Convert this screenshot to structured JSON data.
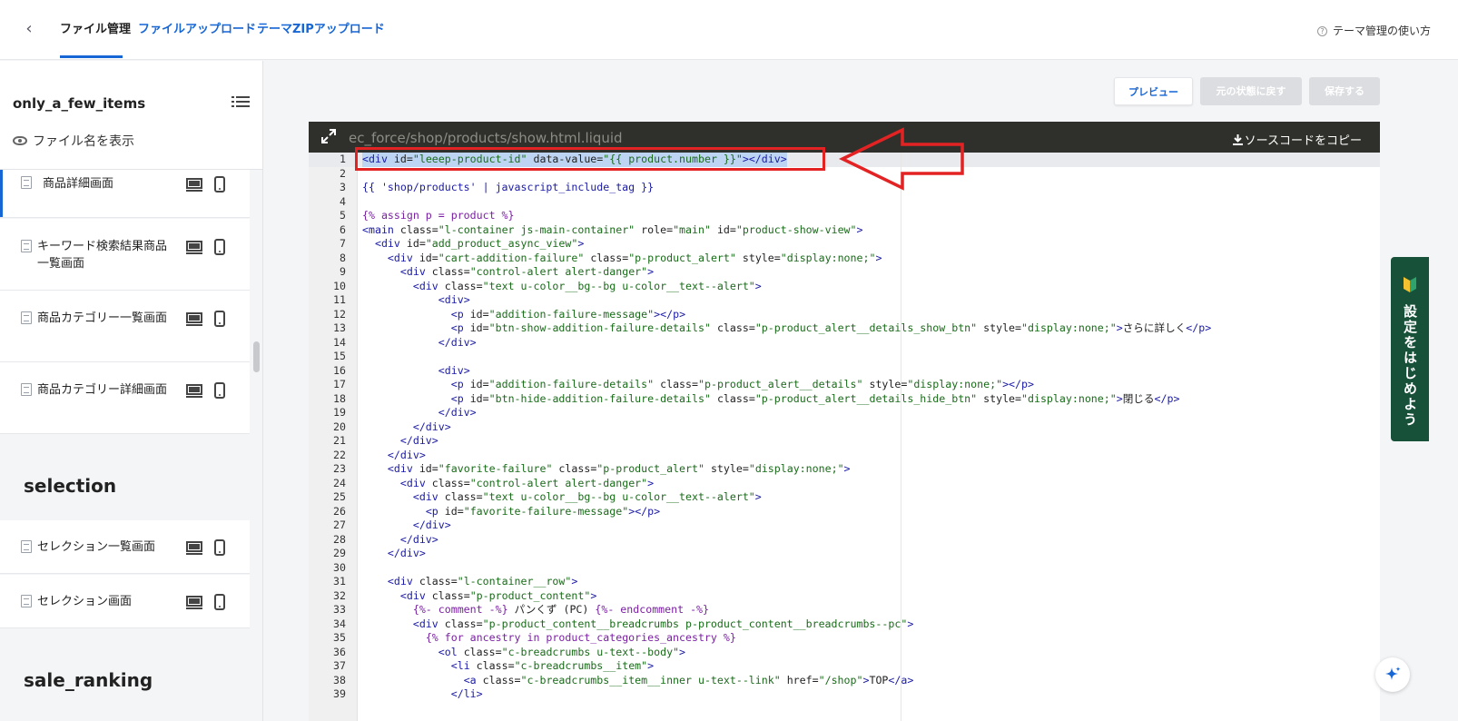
{
  "header": {
    "back_label": "‹",
    "tabs": [
      {
        "label": "ファイル管理",
        "active": true
      },
      {
        "label": "ファイルアップロード",
        "active": false
      },
      {
        "label": "テーマZIPアップロード",
        "active": false
      }
    ],
    "help_label": "テーマ管理の使い方",
    "help_icon": "?"
  },
  "sidebar": {
    "theme_name": "only_a_few_items",
    "show_names_label": "ファイル名を表示",
    "items": [
      {
        "label": "商品詳細画面"
      },
      {
        "label": "キーワード検索結果商品一覧画面"
      },
      {
        "label": "商品カテゴリー一覧画面"
      },
      {
        "label": "商品カテゴリー詳細画面"
      }
    ],
    "section_selection": "selection",
    "selection_items": [
      {
        "label": "セレクション一覧画面"
      },
      {
        "label": "セレクション画面"
      }
    ],
    "section_sale_ranking": "sale_ranking"
  },
  "toolbar": {
    "preview_label": "プレビュー",
    "revert_label": "元の状態に戻す",
    "save_label": "保存する"
  },
  "editor": {
    "file_path": "ec_force/shop/products/show.html.liquid",
    "copy_label": "ソースコードをコピー",
    "lines": [
      "<div id=\"leeep-product-id\" data-value=\"{{ product.number }}\"></div>",
      "",
      "{{ 'shop/products' | javascript_include_tag }}",
      "",
      "{% assign p = product %}",
      "<main class=\"l-container js-main-container\" role=\"main\" id=\"product-show-view\">",
      "  <div id=\"add_product_async_view\">",
      "    <div id=\"cart-addition-failure\" class=\"p-product_alert\" style=\"display:none;\">",
      "      <div class=\"control-alert alert-danger\">",
      "        <div class=\"text u-color__bg--bg u-color__text--alert\">",
      "            <div>",
      "              <p id=\"addition-failure-message\"></p>",
      "              <p id=\"btn-show-addition-failure-details\" class=\"p-product_alert__details_show_btn\" style=\"display:none;\">さらに詳しく</p>",
      "            </div>",
      "",
      "            <div>",
      "              <p id=\"addition-failure-details\" class=\"p-product_alert__details\" style=\"display:none;\"></p>",
      "              <p id=\"btn-hide-addition-failure-details\" class=\"p-product_alert__details_hide_btn\" style=\"display:none;\">閉じる</p>",
      "            </div>",
      "        </div>",
      "      </div>",
      "    </div>",
      "    <div id=\"favorite-failure\" class=\"p-product_alert\" style=\"display:none;\">",
      "      <div class=\"control-alert alert-danger\">",
      "        <div class=\"text u-color__bg--bg u-color__text--alert\">",
      "          <p id=\"favorite-failure-message\"></p>",
      "        </div>",
      "      </div>",
      "    </div>",
      "",
      "    <div class=\"l-container__row\">",
      "      <div class=\"p-product_content\">",
      "        {%- comment -%} パンくず (PC) {%- endcomment -%}",
      "        <div class=\"p-product_content__breadcrumbs p-product_content__breadcrumbs--pc\">",
      "          {% for ancestry in product_categories_ancestry %}",
      "            <ol class=\"c-breadcrumbs u-text--body\">",
      "              <li class=\"c-breadcrumbs__item\">",
      "                <a class=\"c-breadcrumbs__item__inner u-text--link\" href=\"/shop\">TOP</a>",
      "              </li>"
    ]
  },
  "side_tab": {
    "label": "設定をはじめよう"
  },
  "colors": {
    "accent": "#1666d6",
    "annotation": "#e32323",
    "side_tab": "#17513a"
  }
}
